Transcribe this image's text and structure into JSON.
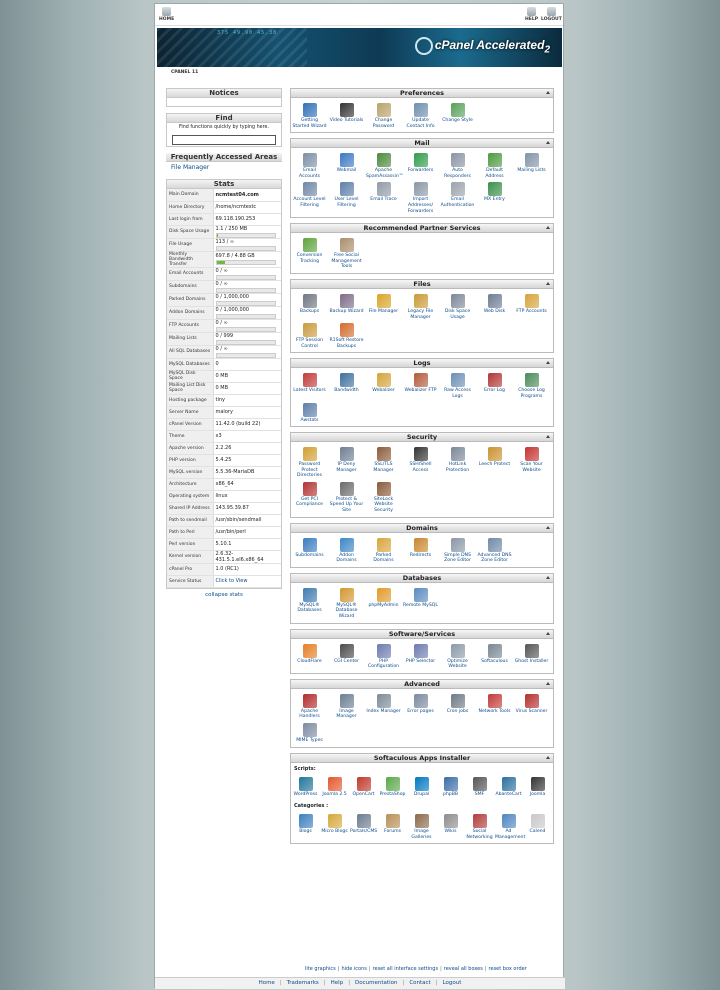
{
  "topbar": {
    "home": "HOME",
    "help": "HELP",
    "logout": "LOGOUT"
  },
  "banner": {
    "logo": "cPanel Accelerated",
    "version_badge": "2",
    "digits": "375  49.90 45.38"
  },
  "breadcrumb": "CPANEL 11",
  "left": {
    "notices_title": "Notices",
    "find_title": "Find",
    "find_hint": "Find functions quickly by typing here.",
    "faa_title": "Frequently Accessed Areas",
    "faa_link": "File Manager",
    "stats_title": "Stats",
    "collapse": "collapse stats",
    "stats": [
      {
        "k": "Main Domain",
        "v": "ncmtest04.com",
        "bold": true
      },
      {
        "k": "Home Directory",
        "v": "/home/ncmtestc"
      },
      {
        "k": "Last login from",
        "v": "69.118.190.253"
      },
      {
        "k": "Disk Space Usage",
        "v": "1.1 / 250 MB",
        "bar": 0.01
      },
      {
        "k": "File Usage",
        "v": "113 / ∞",
        "bar": 0
      },
      {
        "k": "Monthly Bandwidth Transfer",
        "v": "697.8 / 4.88 GB",
        "bar": 0.14
      },
      {
        "k": "Email Accounts",
        "v": "0 / ∞",
        "bar": 0
      },
      {
        "k": "Subdomains",
        "v": "0 / ∞",
        "bar": 0
      },
      {
        "k": "Parked Domains",
        "v": "0 / 1,000,000",
        "bar": 0
      },
      {
        "k": "Addon Domains",
        "v": "0 / 1,000,000",
        "bar": 0
      },
      {
        "k": "FTP Accounts",
        "v": "0 / ∞",
        "bar": 0
      },
      {
        "k": "Mailing Lists",
        "v": "0 / 999",
        "bar": 0
      },
      {
        "k": "All SQL Databases",
        "v": "0 / ∞",
        "bar": 0
      },
      {
        "k": "MySQL Databases",
        "v": "0"
      },
      {
        "k": "MySQL Disk Space",
        "v": "0 MB"
      },
      {
        "k": "Mailing List Disk Space",
        "v": "0 MB"
      },
      {
        "k": "Hosting package",
        "v": "tiny"
      },
      {
        "k": "Server Name",
        "v": "malory"
      },
      {
        "k": "cPanel Version",
        "v": "11.42.0 (build 22)"
      },
      {
        "k": "Theme",
        "v": "x3"
      },
      {
        "k": "Apache version",
        "v": "2.2.26"
      },
      {
        "k": "PHP version",
        "v": "5.4.25"
      },
      {
        "k": "MySQL version",
        "v": "5.5.36-MariaDB"
      },
      {
        "k": "Architecture",
        "v": "x86_64"
      },
      {
        "k": "Operating system",
        "v": "linux"
      },
      {
        "k": "Shared IP Address",
        "v": "143.95.39.87"
      },
      {
        "k": "Path to sendmail",
        "v": "/usr/sbin/sendmail"
      },
      {
        "k": "Path to Perl",
        "v": "/usr/bin/perl"
      },
      {
        "k": "Perl version",
        "v": "5.10.1"
      },
      {
        "k": "Kernel version",
        "v": "2.6.32-431.5.1.el6.x86_64"
      },
      {
        "k": "cPanel Pro",
        "v": "1.0 (RC1)"
      },
      {
        "k": "Service Status",
        "v": "Click to View",
        "link": true
      }
    ]
  },
  "groups": [
    {
      "title": "Preferences",
      "items": [
        {
          "label": "Getting Started Wizard",
          "icon": "wizard-icon",
          "color": "#2f6fb8"
        },
        {
          "label": "Video Tutorials",
          "icon": "clapperboard-icon",
          "color": "#333333"
        },
        {
          "label": "Change Password",
          "icon": "password-icon",
          "color": "#b9a26a"
        },
        {
          "label": "Update Contact Info",
          "icon": "contact-icon",
          "color": "#6d8fae"
        },
        {
          "label": "Change Style",
          "icon": "style-icon",
          "color": "#5aa05a"
        }
      ]
    },
    {
      "title": "Mail",
      "items": [
        {
          "label": "Email Accounts",
          "icon": "email-icon",
          "color": "#7c8fa6"
        },
        {
          "label": "Webmail",
          "icon": "webmail-icon",
          "color": "#3a78c4"
        },
        {
          "label": "Apache SpamAssassin™",
          "icon": "spamassassin-icon",
          "color": "#4b8a3a"
        },
        {
          "label": "Forwarders",
          "icon": "forwarders-icon",
          "color": "#2f9c4a"
        },
        {
          "label": "Auto Responders",
          "icon": "autoresponder-icon",
          "color": "#8a93a3"
        },
        {
          "label": "Default Address",
          "icon": "default-address-icon",
          "color": "#4c9a3d"
        },
        {
          "label": "Mailing Lists",
          "icon": "mailing-lists-icon",
          "color": "#8193a8"
        },
        {
          "label": "Account Level Filtering",
          "icon": "filter-icon",
          "color": "#6e87a6"
        },
        {
          "label": "User Level Filtering",
          "icon": "user-filter-icon",
          "color": "#5c7fa8"
        },
        {
          "label": "Email Trace",
          "icon": "email-trace-icon",
          "color": "#909aa6"
        },
        {
          "label": "Import Addresses/ Forwarders",
          "icon": "import-icon",
          "color": "#8a97a7"
        },
        {
          "label": "Email Authentication",
          "icon": "authentication-icon",
          "color": "#9aa2ab"
        },
        {
          "label": "MX Entry",
          "icon": "mx-entry-icon",
          "color": "#3b8e4a"
        }
      ]
    },
    {
      "title": "Recommended Partner Services",
      "items": [
        {
          "label": "Conversion Tracking",
          "icon": "tracking-icon",
          "color": "#5da33c"
        },
        {
          "label": "Free Social Management Tools",
          "icon": "social-tools-icon",
          "color": "#a98e6c"
        }
      ]
    },
    {
      "title": "Files",
      "items": [
        {
          "label": "Backups",
          "icon": "backup-icon",
          "color": "#6f7780"
        },
        {
          "label": "Backup Wizard",
          "icon": "backup-wizard-icon",
          "color": "#7d6b86"
        },
        {
          "label": "File Manager",
          "icon": "file-manager-icon",
          "color": "#d9a429"
        },
        {
          "label": "Legacy File Manager",
          "icon": "legacy-file-icon",
          "color": "#c99a35"
        },
        {
          "label": "Disk Space Usage",
          "icon": "disk-usage-icon",
          "color": "#7c8898"
        },
        {
          "label": "Web Disk",
          "icon": "web-disk-icon",
          "color": "#6c7d92"
        },
        {
          "label": "FTP Accounts",
          "icon": "ftp-icon",
          "color": "#d6a33a"
        },
        {
          "label": "FTP Session Control",
          "icon": "ftp-session-icon",
          "color": "#c99a3d"
        },
        {
          "label": "R1Soft Restore Backups",
          "icon": "r1soft-icon",
          "color": "#d46b2c"
        }
      ]
    },
    {
      "title": "Logs",
      "items": [
        {
          "label": "Latest Visitors",
          "icon": "visitors-icon",
          "color": "#c23a3a"
        },
        {
          "label": "Bandwidth",
          "icon": "bandwidth-icon",
          "color": "#3f6f9e"
        },
        {
          "label": "Webalizer",
          "icon": "webalizer-icon",
          "color": "#d3a43a"
        },
        {
          "label": "Webalizer FTP",
          "icon": "webalizer-ftp-icon",
          "color": "#b25a3a"
        },
        {
          "label": "Raw Access Logs",
          "icon": "raw-logs-icon",
          "color": "#6d8fb5"
        },
        {
          "label": "Error Log",
          "icon": "error-log-icon",
          "color": "#b23535"
        },
        {
          "label": "Choose Log Programs",
          "icon": "log-programs-icon",
          "color": "#4a8b5a"
        },
        {
          "label": "Awstats",
          "icon": "awstats-icon",
          "color": "#5d7ea8"
        }
      ]
    },
    {
      "title": "Security",
      "items": [
        {
          "label": "Password Protect Directories",
          "icon": "protect-dir-icon",
          "color": "#d2a032"
        },
        {
          "label": "IP Deny Manager",
          "icon": "ip-deny-icon",
          "color": "#6e7f93"
        },
        {
          "label": "SSL/TLS Manager",
          "icon": "ssl-icon",
          "color": "#8a5c3c"
        },
        {
          "label": "SSH/Shell Access",
          "icon": "ssh-icon",
          "color": "#333333"
        },
        {
          "label": "HotLink Protection",
          "icon": "hotlink-icon",
          "color": "#7b8798"
        },
        {
          "label": "Leech Protect",
          "icon": "leech-icon",
          "color": "#c9932f"
        },
        {
          "label": "Scan Your Website",
          "icon": "scan-icon",
          "color": "#c43333"
        },
        {
          "label": "Get PCI Compliance",
          "icon": "pci-icon",
          "color": "#b23232"
        },
        {
          "label": "Protect & Speed Up Your Site",
          "icon": "speed-icon",
          "color": "#6a6a6a"
        },
        {
          "label": "SiteLock Website Security",
          "icon": "sitelock-icon",
          "color": "#8a5a3a"
        }
      ]
    },
    {
      "title": "Domains",
      "items": [
        {
          "label": "Subdomains",
          "icon": "subdomains-icon",
          "color": "#3a7cc0"
        },
        {
          "label": "Addon Domains",
          "icon": "addon-domains-icon",
          "color": "#3c86c4"
        },
        {
          "label": "Parked Domains",
          "icon": "parked-domains-icon",
          "color": "#d8a53c"
        },
        {
          "label": "Redirects",
          "icon": "redirects-icon",
          "color": "#c8872e"
        },
        {
          "label": "Simple DNS Zone Editor",
          "icon": "dns-icon",
          "color": "#8a96a6"
        },
        {
          "label": "Advanced DNS Zone Editor",
          "icon": "advanced-dns-icon",
          "color": "#6f8aa8"
        }
      ]
    },
    {
      "title": "Databases",
      "items": [
        {
          "label": "MySQL® Databases",
          "icon": "mysql-icon",
          "color": "#3e7ab1"
        },
        {
          "label": "MySQL® Database Wizard",
          "icon": "mysql-wizard-icon",
          "color": "#d4972f"
        },
        {
          "label": "phpMyAdmin",
          "icon": "phpmyadmin-icon",
          "color": "#e09a2a"
        },
        {
          "label": "Remote MySQL",
          "icon": "remote-mysql-icon",
          "color": "#5a8bbf"
        }
      ]
    },
    {
      "title": "Software/Services",
      "items": [
        {
          "label": "CloudFlare",
          "icon": "cloudflare-icon",
          "color": "#e67e22"
        },
        {
          "label": "CGI Center",
          "icon": "cgi-icon",
          "color": "#4a4a4a"
        },
        {
          "label": "PHP Configuration",
          "icon": "php-config-icon",
          "color": "#6c7bb0"
        },
        {
          "label": "PHP Selector",
          "icon": "php-selector-icon",
          "color": "#6c7bb0"
        },
        {
          "label": "Optimize Website",
          "icon": "optimize-icon",
          "color": "#8a9aa8"
        },
        {
          "label": "Softaculous",
          "icon": "softaculous-icon",
          "color": "#7a8690"
        },
        {
          "label": "Ghost Installer",
          "icon": "ghost-icon",
          "color": "#555555"
        }
      ]
    },
    {
      "title": "Advanced",
      "items": [
        {
          "label": "Apache Handlers",
          "icon": "apache-icon",
          "color": "#b22b2b"
        },
        {
          "label": "Image Manager",
          "icon": "image-manager-icon",
          "color": "#6b7e92"
        },
        {
          "label": "Index Manager",
          "icon": "index-manager-icon",
          "color": "#7d8a99"
        },
        {
          "label": "Error pages",
          "icon": "error-pages-icon",
          "color": "#7a8aa0"
        },
        {
          "label": "Cron jobs",
          "icon": "cron-icon",
          "color": "#6e7a86"
        },
        {
          "label": "Network Tools",
          "icon": "network-tools-icon",
          "color": "#c23a3a"
        },
        {
          "label": "Virus Scanner",
          "icon": "virus-scanner-icon",
          "color": "#b52f2f"
        },
        {
          "label": "MIME Types",
          "icon": "mime-icon",
          "color": "#7d8ba0"
        }
      ]
    }
  ],
  "softaculous": {
    "title": "Softaculous Apps Installer",
    "scripts_label": "Scripts:",
    "categories_label": "Categories :",
    "scripts": [
      {
        "label": "WordPress",
        "icon": "wordpress-icon",
        "color": "#21759b"
      },
      {
        "label": "Joomla 2.5",
        "icon": "joomla-icon",
        "color": "#e4572e"
      },
      {
        "label": "OpenCart",
        "icon": "opencart-icon",
        "color": "#c0392b"
      },
      {
        "label": "PrestaShop",
        "icon": "prestashop-icon",
        "color": "#5aa84b"
      },
      {
        "label": "Drupal",
        "icon": "drupal-icon",
        "color": "#0077c0"
      },
      {
        "label": "phpBB",
        "icon": "phpbb-icon",
        "color": "#3b6da7"
      },
      {
        "label": "SMF",
        "icon": "smf-icon",
        "color": "#555555"
      },
      {
        "label": "AbanteCart",
        "icon": "abantecart-icon",
        "color": "#2a6f9e"
      },
      {
        "label": "Joomla",
        "icon": "joomla-alt-icon",
        "color": "#333333"
      }
    ],
    "categories": [
      {
        "label": "Blogs",
        "icon": "blogs-icon",
        "color": "#3c7fc1"
      },
      {
        "label": "Micro Blogs",
        "icon": "micro-blogs-icon",
        "color": "#d6a83a"
      },
      {
        "label": "Portals/CMS",
        "icon": "portals-icon",
        "color": "#6b7c90"
      },
      {
        "label": "Forums",
        "icon": "forums-icon",
        "color": "#b88f55"
      },
      {
        "label": "Image Galleries",
        "icon": "galleries-icon",
        "color": "#8a6a4a"
      },
      {
        "label": "Wikis",
        "icon": "wikis-icon",
        "color": "#8d8d8d"
      },
      {
        "label": "Social Networking",
        "icon": "social-icon",
        "color": "#b33b3b"
      },
      {
        "label": "Ad Management",
        "icon": "ad-icon",
        "color": "#4d86bf"
      },
      {
        "label": "Calend",
        "icon": "calendar-icon",
        "color": "#c8c8c8"
      }
    ]
  },
  "interface_links": [
    "lite graphics",
    "hide icons",
    "reset all interface settings",
    "reveal all boxes",
    "reset box order"
  ],
  "footer": [
    "Home",
    "Trademarks",
    "Help",
    "Documentation",
    "Contact",
    "Logout"
  ]
}
